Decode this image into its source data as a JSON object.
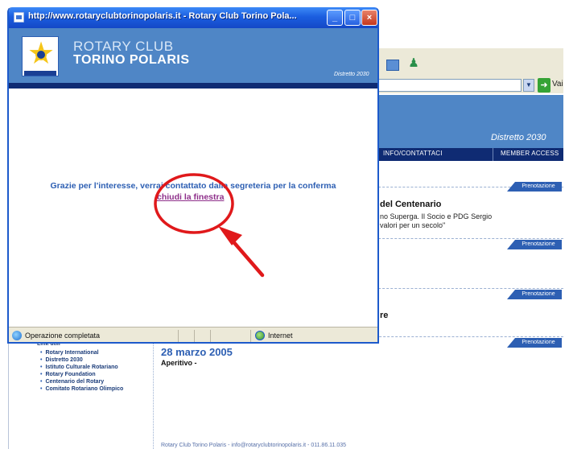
{
  "popup": {
    "title": "http://www.rotaryclubtorinopolaris.it - Rotary Club Torino Pola...",
    "banner": {
      "line1": "ROTARY CLUB",
      "line2": "TORINO POLARIS",
      "distretto": "Distretto 2030"
    },
    "message": "Grazie per l'interesse, verrai contattato dalla segreteria per la conferma",
    "close_link": "chiudi la finestra",
    "status": {
      "text": "Operazione completata",
      "zone": "Internet"
    },
    "buttons": {
      "minimize": "_",
      "maximize": "□",
      "close": "×"
    }
  },
  "background_page": {
    "address_go": "Vai",
    "distretto": "Distretto 2030",
    "nav": [
      "INFO/CONTATTACI",
      "MEMBER ACCESS"
    ],
    "badge": "Prenotazione",
    "news": {
      "title": "del Centenario",
      "body_lines": [
        "no Superga. Il Socio e PDG Sergio",
        "valori per un secolo\""
      ],
      "tail": "re"
    },
    "sidebar": {
      "title": "Link utili",
      "links": [
        "Rotary International",
        "Distretto 2030",
        "Istituto Culturale Rotariano",
        "Rotary Foundation",
        "Centenario del Rotary",
        "Comitato Rotariano Olimpico"
      ]
    },
    "event": {
      "date": "28 marzo 2005",
      "title": "Aperitivo -"
    },
    "footer": "Rotary Club Torino Polaris - info@rotaryclubtorinopolaris.it - 011.86.11.035"
  },
  "annotation": {
    "color": "#e0191b"
  }
}
